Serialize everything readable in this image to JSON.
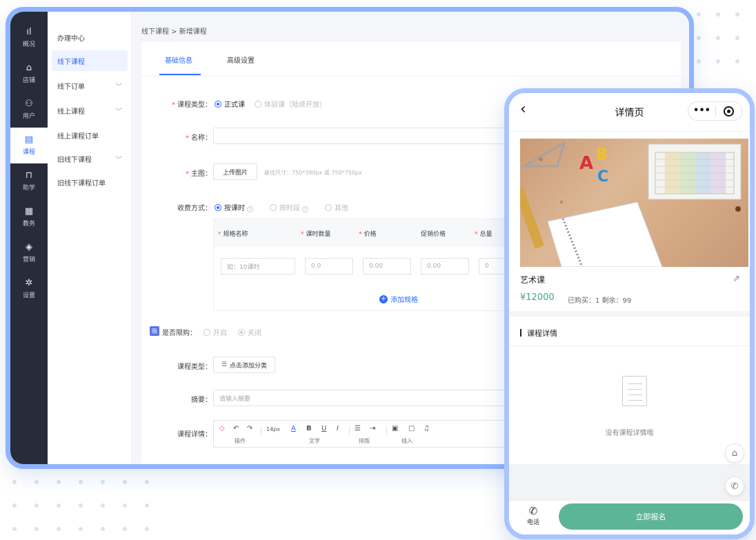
{
  "nav": {
    "items": [
      {
        "label": "概况",
        "icon": "chart-icon"
      },
      {
        "label": "店铺",
        "icon": "store-icon"
      },
      {
        "label": "用户",
        "icon": "users-icon"
      },
      {
        "label": "课程",
        "icon": "course-icon",
        "active": true
      },
      {
        "label": "助学",
        "icon": "assist-icon"
      },
      {
        "label": "教务",
        "icon": "academic-icon"
      },
      {
        "label": "营销",
        "icon": "tag-icon"
      },
      {
        "label": "设置",
        "icon": "gear-icon"
      }
    ]
  },
  "submenu": {
    "title": "办理中心",
    "items": [
      {
        "label": "线下课程",
        "active": true
      },
      {
        "label": "线下订单",
        "expandable": true
      },
      {
        "label": "线上课程",
        "expandable": true
      },
      {
        "label": "线上课程订单"
      },
      {
        "label": "旧线下课程",
        "expandable": true
      },
      {
        "label": "旧线下课程订单"
      }
    ]
  },
  "breadcrumb": "线下课程 > 新增课程",
  "tabs": [
    "基础信息",
    "高级设置"
  ],
  "form": {
    "course_type_label": "课程类型：",
    "course_type_options": [
      "正式课",
      "体验课（陆续开放）"
    ],
    "name_label": "名称：",
    "main_image_label": "主图：",
    "upload_button": "上传图片",
    "upload_hint": "最佳尺寸：750*380px 或 750*750px",
    "fee_label": "收费方式：",
    "fee_options": [
      "按课时",
      "按时段",
      "其他"
    ],
    "spec_headers": [
      "规格名称",
      "课时数量",
      "价格",
      "促销价格",
      "总量"
    ],
    "spec_placeholders": [
      "如：10课时",
      "0.0",
      "0.00",
      "0.00",
      "0"
    ],
    "add_spec": "添加规格",
    "limit_label": "是否限购：",
    "limit_badge": "限",
    "limit_options": [
      "开启",
      "关闭"
    ],
    "category_label": "课程类型：",
    "category_button": "点击添加分类",
    "summary_label": "摘要：",
    "summary_placeholder": "请输入摘要",
    "detail_label": "课程详情：",
    "editor_tools": [
      "↶",
      "↷",
      "14px",
      "A",
      "B",
      "U",
      "I"
    ],
    "editor_groups": [
      "操作",
      "文字",
      "排版",
      "插入"
    ]
  },
  "phone": {
    "title": "详情页",
    "course_name": "艺术课",
    "price": "¥12000",
    "meta": "已购买：1   剩余：99",
    "section_title": "课程详情",
    "empty_text": "没有课程详情哦",
    "call_label": "电话",
    "enroll_button": "立即报名"
  },
  "colors": {
    "accent": "#2f6bff",
    "nav_bg": "#282c3a",
    "enroll": "#5db598",
    "frame": "#8fb4ff"
  }
}
